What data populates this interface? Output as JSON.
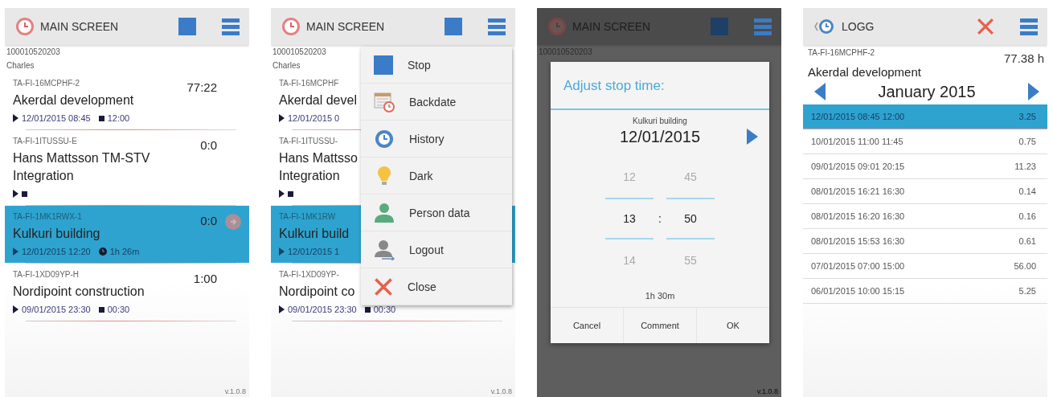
{
  "screens": [
    {
      "kind": "main",
      "header": {
        "title": "MAIN SCREEN",
        "logo": {
          "kind": "clock"
        },
        "actions": [
          {
            "kind": "stop"
          },
          {
            "kind": "menu"
          }
        ]
      },
      "account": "100010520203",
      "user": "Charles",
      "tasks": [
        {
          "code": "TA-FI-16MCPHF-2",
          "name": "Akerdal development",
          "time": "77:22",
          "start": "12/01/2015 08:45",
          "end": {
            "kind": "stop",
            "text": "12:00"
          },
          "selected": false
        },
        {
          "code": "TA-FI-1ITUSSU-E",
          "name": "Hans Mattsson TM-STV Integration",
          "time": "0:0",
          "end": {
            "kind": "stop"
          },
          "selected": false
        },
        {
          "code": "TA-FI-1MK1RWX-1",
          "name": "Kulkuri building",
          "time": "0:0",
          "start": "12/01/2015 12:20",
          "end": {
            "kind": "clock",
            "text": "1h 26m"
          },
          "selected": true,
          "action_button": true
        },
        {
          "code": "TA-FI-1XD09YP-H",
          "name": "Nordipoint construction",
          "time": "1:00",
          "start": "09/01/2015 23:30",
          "end": {
            "kind": "stop",
            "text": "00:30"
          },
          "selected": false
        }
      ],
      "version": "v.1.0.8"
    },
    {
      "kind": "main",
      "header": {
        "title": "MAIN SCREEN",
        "logo": {
          "kind": "clock"
        },
        "actions": [
          {
            "kind": "stop"
          },
          {
            "kind": "menu"
          }
        ]
      },
      "account": "100010520203",
      "user": "Charles",
      "tasks": [
        {
          "code": "TA-FI-16MCPHF",
          "name": "Akerdal devel",
          "start": "12/01/2015 0",
          "selected": false
        },
        {
          "code": "TA-FI-1ITUSSU-",
          "name": "Hans Mattsso Integration",
          "end": {
            "kind": "stop"
          },
          "selected": false
        },
        {
          "code": "TA-FI-1MK1RW",
          "name": "Kulkuri build",
          "start": "12/01/2015 1",
          "selected": true
        },
        {
          "code": "TA-FI-1XD09YP-",
          "name": "Nordipoint co",
          "start": "09/01/2015 23:30",
          "end": {
            "kind": "stop",
            "text": "00:30"
          },
          "selected": false
        }
      ],
      "menu": [
        {
          "kind": "stop",
          "label": "Stop"
        },
        {
          "kind": "backdate",
          "label": "Backdate"
        },
        {
          "kind": "history",
          "label": "History"
        },
        {
          "kind": "dark",
          "label": "Dark"
        },
        {
          "kind": "person",
          "label": "Person data"
        },
        {
          "kind": "logout",
          "label": "Logout"
        },
        {
          "kind": "close",
          "label": "Close"
        }
      ],
      "version": "v.1.0.8"
    },
    {
      "kind": "dialog",
      "header": {
        "title": "MAIN SCREEN",
        "logo": {
          "kind": "clock"
        },
        "actions": [
          {
            "kind": "stop"
          },
          {
            "kind": "menu"
          }
        ]
      },
      "account": "100010520203",
      "dialog": {
        "title": "Adjust stop time:",
        "task": "Kulkuri building",
        "date": "12/01/2015",
        "hours": [
          "12",
          "13",
          "14"
        ],
        "minutes": [
          "45",
          "50",
          "55"
        ],
        "separator": ":",
        "duration": "1h 30m",
        "buttons": [
          "Cancel",
          "Comment",
          "OK"
        ]
      },
      "version": "v.1.0.8"
    },
    {
      "kind": "log",
      "header": {
        "title": "LOGG",
        "logo": {
          "kind": "history"
        },
        "actions": [
          {
            "kind": "close"
          },
          {
            "kind": "menu"
          }
        ]
      },
      "code": "TA-FI-16MCPHF-2",
      "total": "77.38 h",
      "name": "Akerdal development",
      "month": "January 2015",
      "entries": [
        {
          "text": "12/01/2015 08:45 12:00",
          "hours": "3.25",
          "selected": true
        },
        {
          "text": "10/01/2015 11:00 11:45",
          "hours": "0.75",
          "selected": false
        },
        {
          "text": "09/01/2015 09:01 20:15",
          "hours": "11.23",
          "selected": false
        },
        {
          "text": "08/01/2015 16:21 16:30",
          "hours": "0.14",
          "selected": false
        },
        {
          "text": "08/01/2015 16:20 16:30",
          "hours": "0.16",
          "selected": false
        },
        {
          "text": "08/01/2015 15:53 16:30",
          "hours": "0.61",
          "selected": false
        },
        {
          "text": "07/01/2015 07:00 15:00",
          "hours": "56.00",
          "selected": false
        },
        {
          "text": "06/01/2015 10:00 15:15",
          "hours": "5.25",
          "selected": false
        }
      ]
    }
  ]
}
